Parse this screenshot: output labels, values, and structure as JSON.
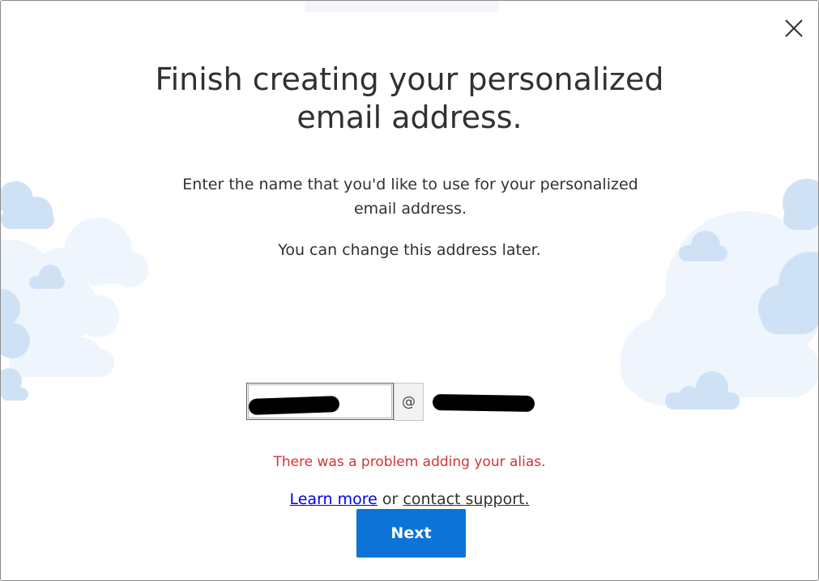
{
  "dialog": {
    "title_line1": "Finish creating your personalized",
    "title_line2": "email address.",
    "description": "Enter the name that you'd like to use for your personalized email address.",
    "note": "You can change this address later.",
    "alias": {
      "value": "",
      "at_symbol": "@",
      "domain": ""
    },
    "error_message": "There was a problem adding your alias.",
    "help": {
      "learn_more": "Learn more",
      "connector": "or",
      "contact_support": "contact support."
    },
    "next_label": "Next",
    "close_icon": "close-icon"
  },
  "colors": {
    "accent": "#0b74d6",
    "error": "#d13438",
    "link": "#0000ee",
    "text": "#323130",
    "cloud_light": "#eef5fc",
    "cloud_mid": "#cfe2f5"
  }
}
